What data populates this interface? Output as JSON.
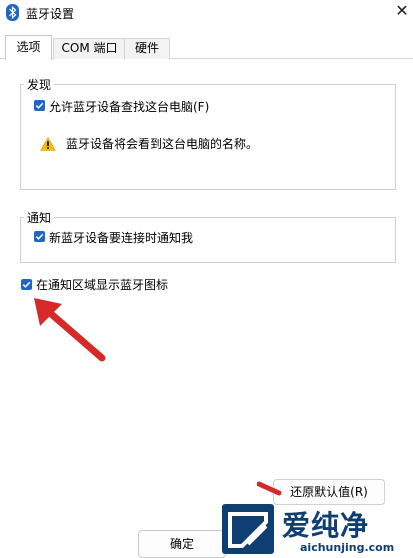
{
  "window": {
    "title": "蓝牙设置",
    "close_glyph": "✕"
  },
  "tabs": [
    {
      "label": "选项",
      "active": true
    },
    {
      "label": "COM 端口",
      "active": false
    },
    {
      "label": "硬件",
      "active": false
    }
  ],
  "discovery": {
    "legend": "发现",
    "allow_find_label": "允许蓝牙设备查找这台电脑(F)",
    "allow_find_checked": true,
    "warning_text": "蓝牙设备将会看到这台电脑的名称。"
  },
  "notify": {
    "legend": "通知",
    "new_device_label": "新蓝牙设备要连接时通知我",
    "new_device_checked": true
  },
  "tray": {
    "show_icon_label": "在通知区域显示蓝牙图标",
    "show_icon_checked": true
  },
  "buttons": {
    "restore_defaults": "还原默认值(R)",
    "ok": "确定"
  },
  "watermark": {
    "title": "爱纯净",
    "url": "aichunjing.com"
  },
  "colors": {
    "checkbox": "#1f67c4",
    "arrow": "#d42a2a",
    "warning": "#f2c200",
    "watermark": "#0f3e73"
  }
}
